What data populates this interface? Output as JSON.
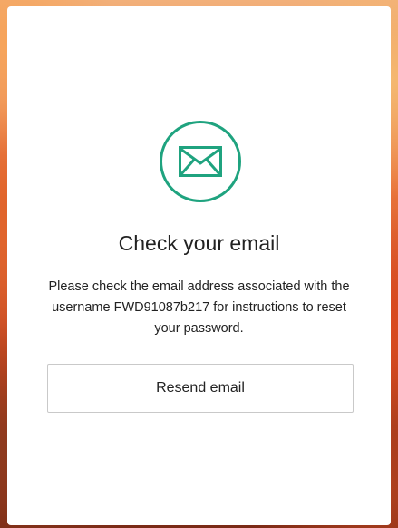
{
  "card": {
    "title": "Check your email",
    "message": "Please check the email address associated with the username FWD91087b217 for instructions to reset your password.",
    "resend_label": "Resend email",
    "icon": "envelope-icon"
  },
  "colors": {
    "accent": "#1fa37f",
    "text": "#222222",
    "button_border": "#c9c9c9",
    "card_bg": "#ffffff"
  }
}
